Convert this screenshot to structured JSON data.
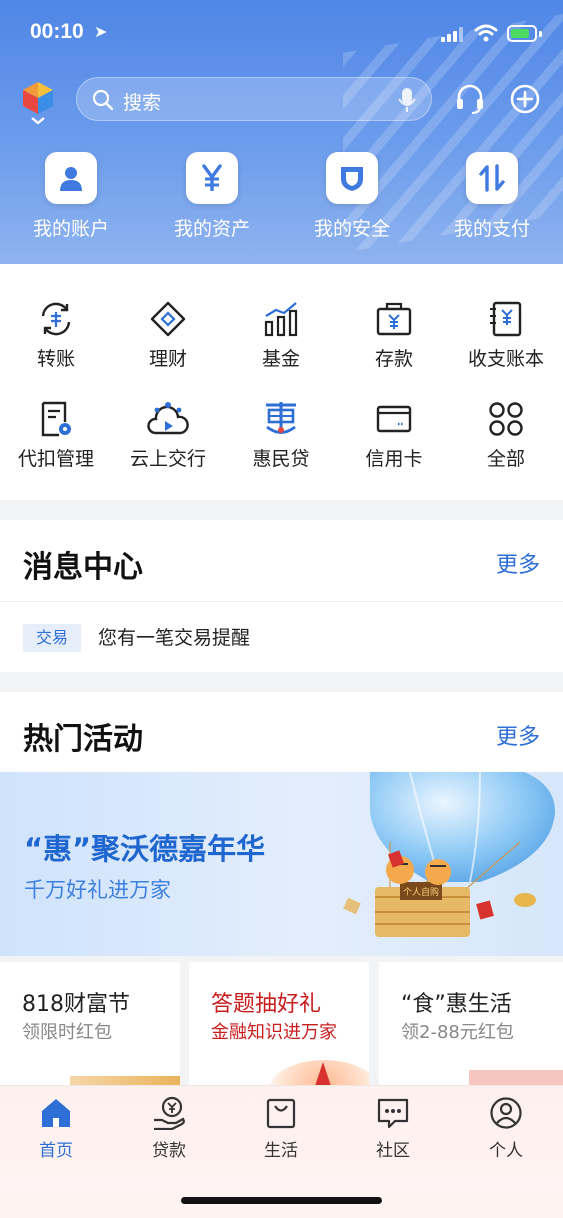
{
  "status_bar": {
    "time": "00:10",
    "location_glyph": "➤"
  },
  "search": {
    "placeholder": "搜索"
  },
  "header_actions": [
    "customer-service-icon",
    "add-icon"
  ],
  "quick_actions": [
    {
      "label": "我的账户",
      "icon": "person-icon"
    },
    {
      "label": "我的资产",
      "icon": "yen-icon"
    },
    {
      "label": "我的安全",
      "icon": "shield-icon"
    },
    {
      "label": "我的支付",
      "icon": "transfer-arrows-icon"
    }
  ],
  "services": [
    {
      "label": "转账",
      "icon": "transfer-icon"
    },
    {
      "label": "理财",
      "icon": "diamond-icon"
    },
    {
      "label": "基金",
      "icon": "fund-chart-icon"
    },
    {
      "label": "存款",
      "icon": "deposit-icon"
    },
    {
      "label": "收支账本",
      "icon": "ledger-icon"
    },
    {
      "label": "代扣管理",
      "icon": "withhold-icon"
    },
    {
      "label": "云上交行",
      "icon": "cloud-icon"
    },
    {
      "label": "惠民贷",
      "icon": "loan-icon"
    },
    {
      "label": "信用卡",
      "icon": "credit-card-icon"
    },
    {
      "label": "全部",
      "icon": "all-apps-icon"
    }
  ],
  "messages": {
    "title": "消息中心",
    "more": "更多",
    "items": [
      {
        "tag": "交易",
        "text": "您有一笔交易提醒"
      }
    ]
  },
  "activities": {
    "title": "热门活动",
    "more": "更多",
    "banner": {
      "title": "“惠”聚沃德嘉年华",
      "subtitle": "千万好礼进万家",
      "basket_text": "个人自购"
    },
    "cards": [
      {
        "title": "818财富节",
        "subtitle": "领限时红包",
        "title_color": "#222222",
        "subtitle_color": "#888888"
      },
      {
        "title": "答题抽好礼",
        "subtitle": "金融知识进万家",
        "title_color": "#c81d1d",
        "subtitle_color": "#c81d1d"
      },
      {
        "title": "“食”惠生活",
        "subtitle": "领2-88元红包",
        "title_color": "#222222",
        "subtitle_color": "#888888"
      }
    ]
  },
  "tabbar": [
    {
      "label": "首页",
      "icon": "home-icon",
      "active": true
    },
    {
      "label": "贷款",
      "icon": "loan-hand-icon",
      "active": false
    },
    {
      "label": "生活",
      "icon": "shopping-bag-icon",
      "active": false
    },
    {
      "label": "社区",
      "icon": "chat-bubble-icon",
      "active": false
    },
    {
      "label": "个人",
      "icon": "profile-icon",
      "active": false
    }
  ],
  "colors": {
    "accent": "#2d6fd6",
    "header_top": "#4f86e6",
    "header_bottom": "#8fb3ef",
    "promo_red": "#c81d1d"
  }
}
